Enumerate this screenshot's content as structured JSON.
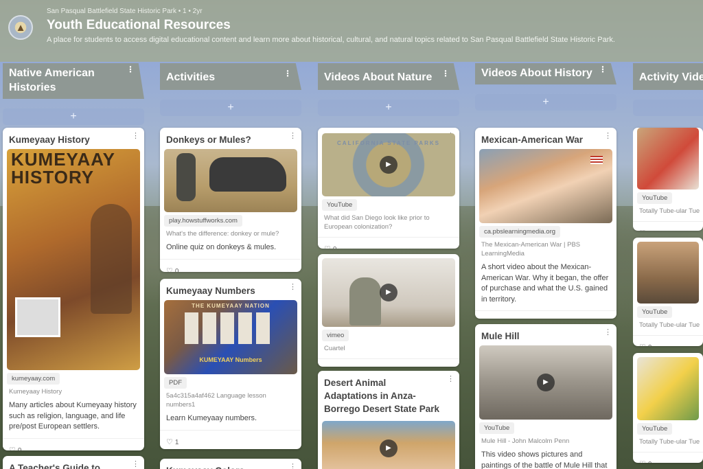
{
  "header": {
    "breadcrumb": "San Pasqual Battlefield State Historic Park • 1 • 2yr",
    "title": "Youth Educational Resources",
    "description": "A place for students to access digital educational content and learn more about historical, cultural, and natural topics related to San Pasqual Battlefield State Historic Park."
  },
  "icons": {
    "menu": "more-vertical-icon",
    "add": "plus-icon",
    "like": "heart-icon",
    "play": "play-icon"
  },
  "add_label": "+",
  "columns": [
    {
      "title": "Native American Histories",
      "cards": [
        {
          "title": "Kumeyaay History",
          "image_text": "KUMEYAAY HISTORY",
          "source": "kumeyaay.com",
          "meta": "Kumeyaay History",
          "desc": "Many articles about Kumeyaay history such as religion, language, and life pre/post European settlers.",
          "likes": "0"
        },
        {
          "title": "A Teacher's Guide to"
        }
      ]
    },
    {
      "title": "Activities",
      "cards": [
        {
          "title": "Donkeys or Mules?",
          "source": "play.howstuffworks.com",
          "meta": "What's the difference: donkey or mule?",
          "desc": "Online quiz on donkeys & mules.",
          "likes": "0"
        },
        {
          "title": "Kumeyaay Numbers",
          "image_text": "THE KUMEYAAY NATION",
          "image_sub": "KUMEYAAY Numbers",
          "source": "PDF",
          "meta": "5a4c315a4af462 Language lesson numbers1",
          "desc": "Learn Kumeyaay numbers.",
          "likes": "1"
        },
        {
          "title": "Kumeyaay Colors"
        }
      ]
    },
    {
      "title": "Videos About Nature",
      "cards": [
        {
          "title": "",
          "image_text": "CALIFORNIA STATE PARKS",
          "source": "YouTube",
          "meta": "What did San Diego look like prior to European colonization?",
          "likes": "0"
        },
        {
          "title": "",
          "source": "vimeo",
          "meta": "Cuartel",
          "likes": "0"
        },
        {
          "title": "Desert Animal Adaptations in Anza-Borrego Desert State Park"
        }
      ]
    },
    {
      "title": "Videos About History",
      "cards": [
        {
          "title": "Mexican-American War",
          "source": "ca.pbslearningmedia.org",
          "meta": "The Mexican-American War | PBS LearningMedia",
          "desc": "A short video about the Mexican-American War. Why it began, the offer of purchase and what the U.S. gained in territory.",
          "likes": "0"
        },
        {
          "title": "Mule Hill",
          "source": "YouTube",
          "meta": "Mule Hill - John Malcolm Penn",
          "desc": "This video shows pictures and paintings of the battle of Mule Hill that occurred after the Battle of"
        }
      ]
    },
    {
      "title": "Activity Videos",
      "cards": [
        {
          "source": "YouTube",
          "meta": "Totally Tube-ular Tue",
          "likes": "0"
        },
        {
          "source": "YouTube",
          "meta": "Totally Tube-ular Tue",
          "likes": "0"
        },
        {
          "source": "YouTube",
          "meta": "Totally Tube-ular Tue",
          "likes": "0"
        }
      ]
    }
  ]
}
